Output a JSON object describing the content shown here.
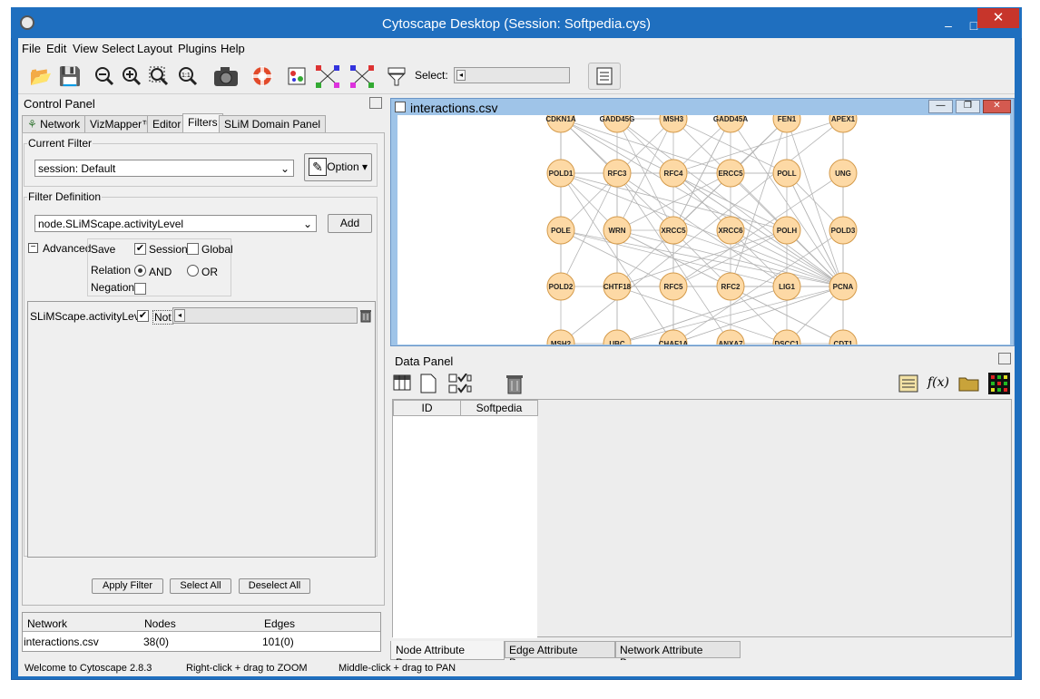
{
  "window": {
    "title": "Cytoscape Desktop (Session: Softpedia.cys)",
    "minimize": "–",
    "maximize": "□",
    "close": "✕"
  },
  "menu": [
    "File",
    "Edit",
    "View",
    "Select",
    "Layout",
    "Plugins",
    "Help"
  ],
  "toolbar": {
    "select_label": "Select:"
  },
  "control_panel": {
    "title": "Control Panel",
    "tabs": [
      "Network",
      "VizMapper™",
      "Editor",
      "Filters",
      "SLiM Domain Panel"
    ],
    "current_filter_label": "Current Filter",
    "current_filter_value": "session: Default",
    "option_button": "Option",
    "filter_definition_label": "Filter Definition",
    "filter_definition_value": "node.SLiMScape.activityLevel",
    "add_button": "Add",
    "advanced_label": "Advanced",
    "save_label": "Save",
    "session_label": "Session",
    "global_label": "Global",
    "relation_label": "Relation",
    "and_label": "AND",
    "or_label": "OR",
    "negation_label": "Negation",
    "filter_item_label": "SLiMScape.activityLevel",
    "not_label": "Not",
    "apply_filter": "Apply Filter",
    "select_all": "Select All",
    "deselect_all": "Deselect All",
    "net_table": {
      "headers": [
        "Network",
        "Nodes",
        "Edges"
      ],
      "rows": [
        [
          "interactions.csv",
          "38(0)",
          "101(0)"
        ]
      ]
    }
  },
  "network_window": {
    "title": "interactions.csv"
  },
  "nodes": {
    "row0": [
      "CDKN1A",
      "GADD45G",
      "MSH3",
      "GADD45A",
      "FEN1",
      "APEX1"
    ],
    "row1": [
      "POLD1",
      "RFC3",
      "RFC4",
      "ERCC5",
      "POLL",
      "UNG"
    ],
    "row2": [
      "POLE",
      "WRN",
      "XRCC5",
      "XRCC6",
      "POLH",
      "POLD3"
    ],
    "row3": [
      "POLD2",
      "CHTF18",
      "RFC5",
      "RFC2",
      "LIG1",
      "PCNA"
    ],
    "row4": [
      "MSH2",
      "UBC",
      "CHAF1A",
      "ANXA7",
      "DSCC1",
      "CDT1"
    ]
  },
  "data_panel": {
    "title": "Data Panel",
    "columns": [
      "ID",
      "Softpedia"
    ],
    "tabs": [
      "Node Attribute Browser",
      "Edge Attribute Browser",
      "Network Attribute Browser"
    ],
    "fx_label": "f(x)"
  },
  "status": {
    "left": "Welcome to Cytoscape 2.8.3",
    "mid": "Right-click + drag to ZOOM",
    "right": "Middle-click + drag to PAN"
  },
  "colors": {
    "node_fill": "#fdd9a5",
    "node_stroke": "#d49a4a",
    "titlebar": "#1f6fbf",
    "edge": "#b4b4b4"
  }
}
